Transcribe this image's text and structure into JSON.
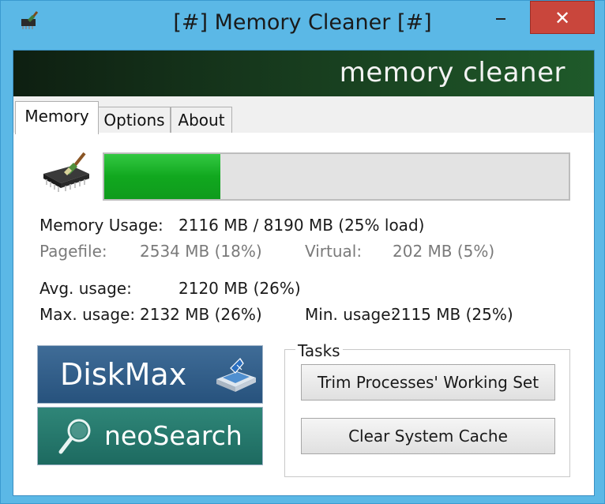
{
  "window": {
    "title": "[#] Memory Cleaner [#]",
    "close_glyph": "✕",
    "accent_color": "#5bb8e6",
    "close_color": "#c9463c"
  },
  "banner": {
    "text": "memory cleaner"
  },
  "tabs": [
    {
      "label": "Memory",
      "active": true
    },
    {
      "label": "Options",
      "active": false
    },
    {
      "label": "About",
      "active": false
    }
  ],
  "memory": {
    "load_percent": 25,
    "bar_color": "#1aae28",
    "usage_label": "Memory Usage:",
    "usage_value": "2116 MB / 8190 MB  (25% load)",
    "pagefile_label": "Pagefile:",
    "pagefile_value": "2534 MB (18%)",
    "virtual_label": "Virtual:",
    "virtual_value": "202 MB (5%)",
    "avg_label": "Avg. usage:",
    "avg_value": "2120 MB (26%)",
    "max_label": "Max. usage:",
    "max_value": "2132 MB (26%)",
    "min_label": "Min. usage:",
    "min_value": "2115 MB (25%)"
  },
  "promos": {
    "diskmax": {
      "label": "DiskMax",
      "icon": "disk-icon"
    },
    "neosearch": {
      "label": "neoSearch",
      "icon": "magnifier-icon"
    }
  },
  "tasks": {
    "legend": "Tasks",
    "trim_label": "Trim Processes' Working Set",
    "clear_label": "Clear System Cache"
  }
}
